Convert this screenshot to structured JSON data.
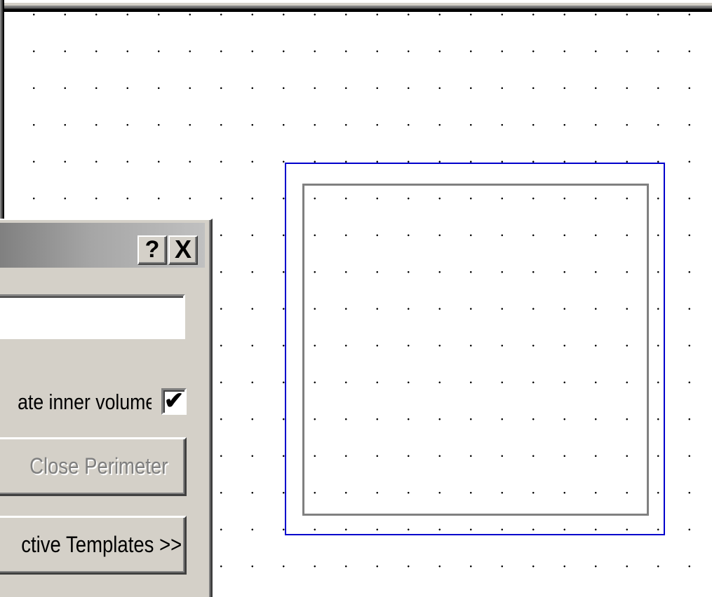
{
  "dialog": {
    "help_button": "?",
    "close_button": "X",
    "name_input": {
      "value": ""
    },
    "inner_volume_label": "ate inner volume",
    "inner_volume_checkbox": {
      "checked": true,
      "glyph": "✔"
    },
    "close_perimeter_button": "Close  Perimeter",
    "templates_button": "ctive Templates >>"
  },
  "colors": {
    "outer_rect": "#0000cc",
    "inner_rect": "#808080",
    "dialog_face": "#d4d0c8"
  }
}
